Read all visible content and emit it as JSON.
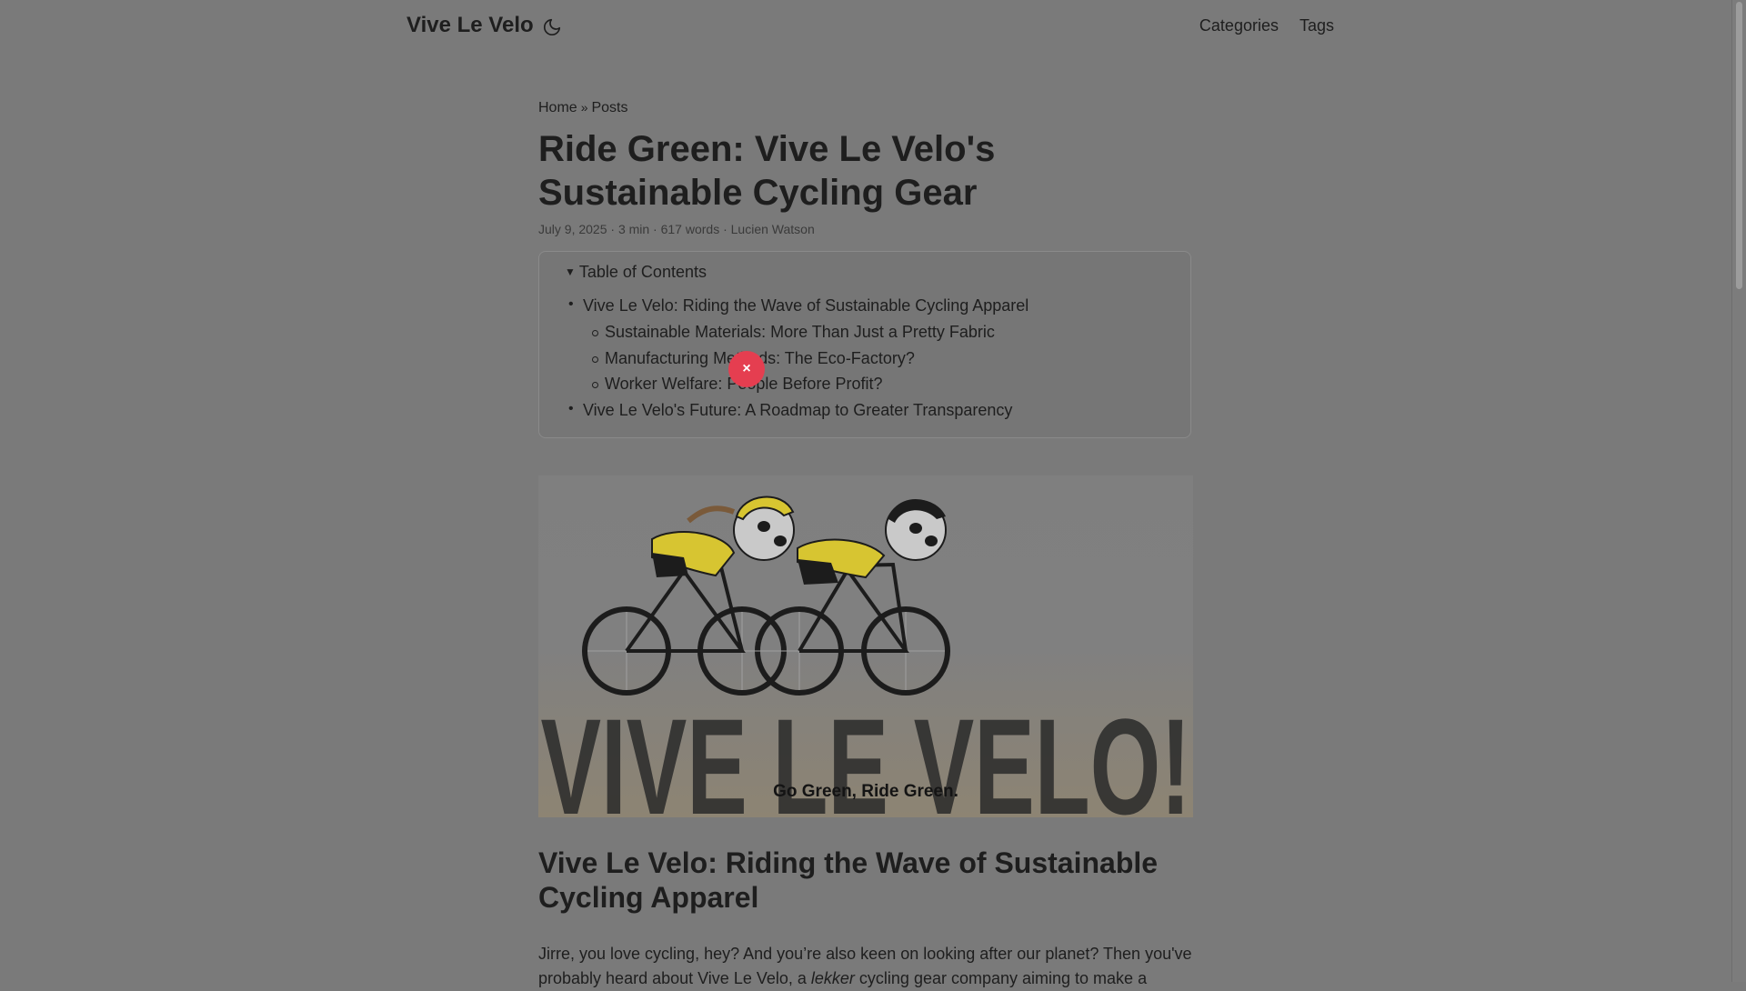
{
  "site": {
    "title": "Vive Le Velo"
  },
  "nav": {
    "items": [
      "Categories",
      "Tags"
    ]
  },
  "theme_toggle": {
    "icon": "moon-icon"
  },
  "breadcrumb": {
    "home": "Home",
    "separator": "»",
    "posts": "Posts"
  },
  "post": {
    "title": "Ride Green: Vive Le Velo's Sustainable Cycling Gear",
    "meta": "July 9, 2025 · 3 min · 617 words · Lucien Watson"
  },
  "toc": {
    "summary": "Table of Contents",
    "items": [
      {
        "label": "Vive Le Velo: Riding the Wave of Sustainable Cycling Apparel",
        "level": 1
      },
      {
        "label": "Sustainable Materials: More Than Just a Pretty Fabric",
        "level": 2
      },
      {
        "label": "Manufacturing Methods: The Eco-Factory?",
        "level": 2
      },
      {
        "label": "Worker Welfare: People Before Profit?",
        "level": 2
      },
      {
        "label": "Vive Le Velo's Future: A Roadmap to Greater Transparency",
        "level": 1
      }
    ]
  },
  "overlay": {
    "close_label": "×",
    "color": "#e53e50"
  },
  "cover": {
    "brand_text": "VIVE LE VELO!",
    "tagline": "Go Green, Ride Green.",
    "jersey_color": "#d7c531"
  },
  "section": {
    "heading": "Vive Le Velo: Riding the Wave of Sustainable Cycling Apparel",
    "para_before": "Jirre, you love cycling, hey? And you’re also keen on looking after our planet? Then you've probably heard about Vive Le Velo, a ",
    "para_emph": "lekker",
    "para_after": " cycling gear company aiming to make a"
  }
}
